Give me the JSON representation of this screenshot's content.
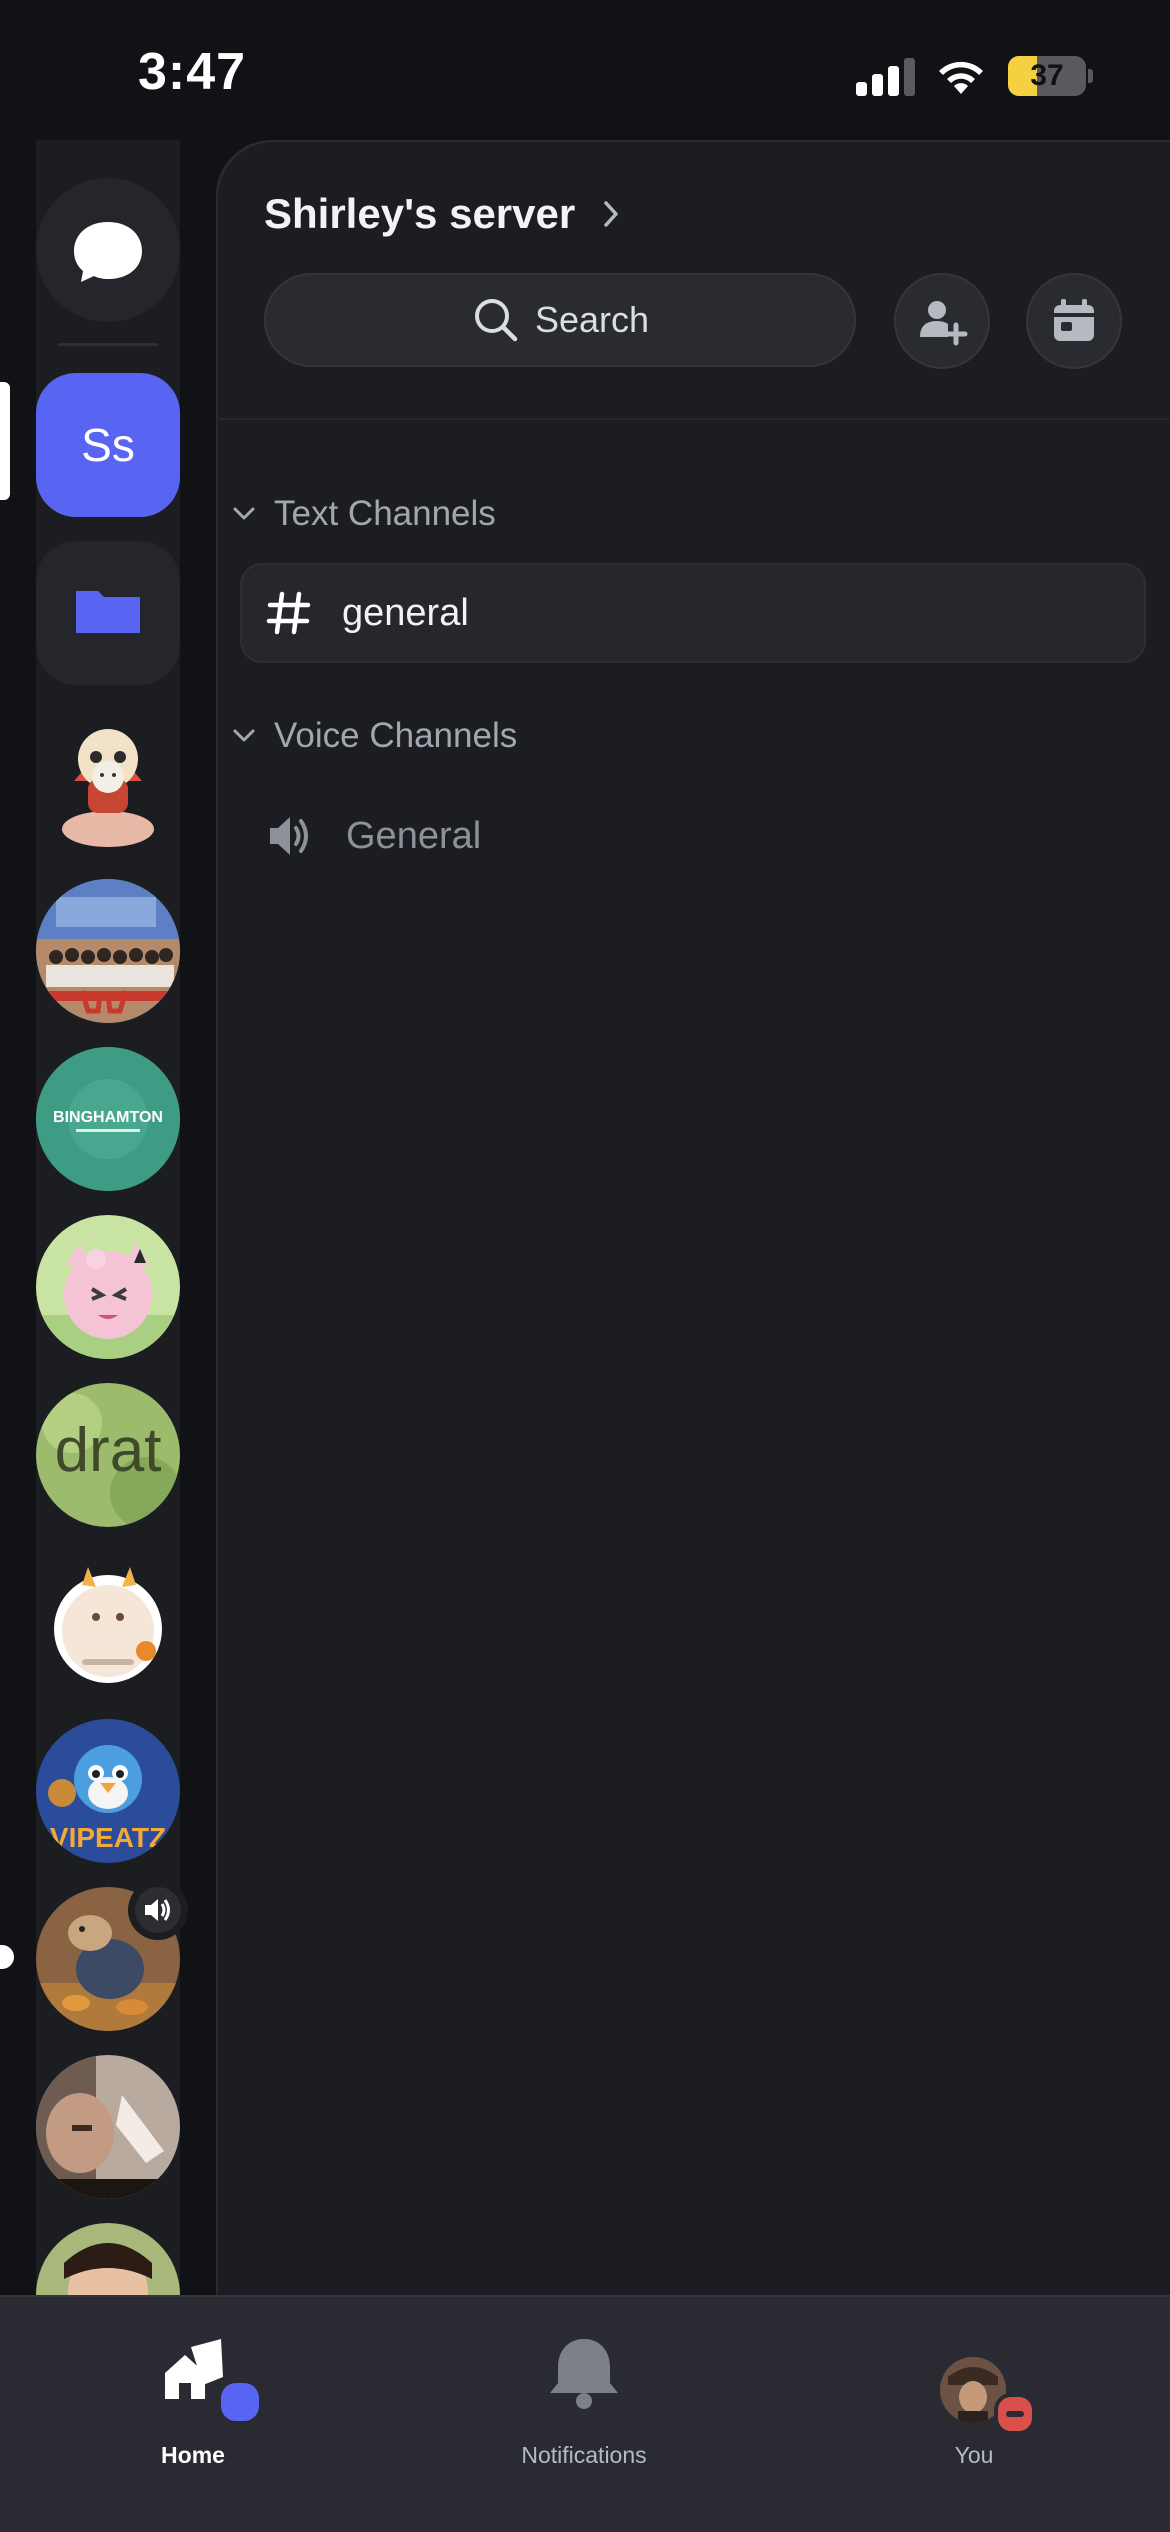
{
  "status_bar": {
    "time": "3:47",
    "battery_level": "37",
    "battery_fraction": 0.37,
    "signal_bars_active": 3
  },
  "server": {
    "name": "Shirley's server"
  },
  "header": {
    "search_label": "Search"
  },
  "rail": {
    "dm_icon": "chat-bubble-icon",
    "active_server_initials": "Ss",
    "folder_icon": "folder-icon",
    "server_icons": [
      "lion-dance-frog-sticker",
      "group-photo",
      "binghamton-logo",
      "jigglypuff",
      "drat-text",
      "cream-dragon-sticker",
      "piplup-eats-logo",
      "meerkat-photo",
      "person-photo",
      "partial-photo"
    ],
    "binghamton_text": "BINGHAMTON",
    "drat_text": "drat",
    "vipeatz_text": "VIPEATZ"
  },
  "channels": {
    "text_category": "Text Channels",
    "voice_category": "Voice Channels",
    "text": [
      {
        "name": "general"
      }
    ],
    "voice": [
      {
        "name": "General"
      }
    ]
  },
  "tabs": [
    {
      "label": "Home",
      "icon": "home-icon"
    },
    {
      "label": "Notifications",
      "icon": "bell-icon"
    },
    {
      "label": "You",
      "icon": "avatar"
    }
  ],
  "colors": {
    "brand": "#5865f2",
    "background": "#1c1d22",
    "rail": "#111216",
    "dnd": "#d9504a"
  }
}
